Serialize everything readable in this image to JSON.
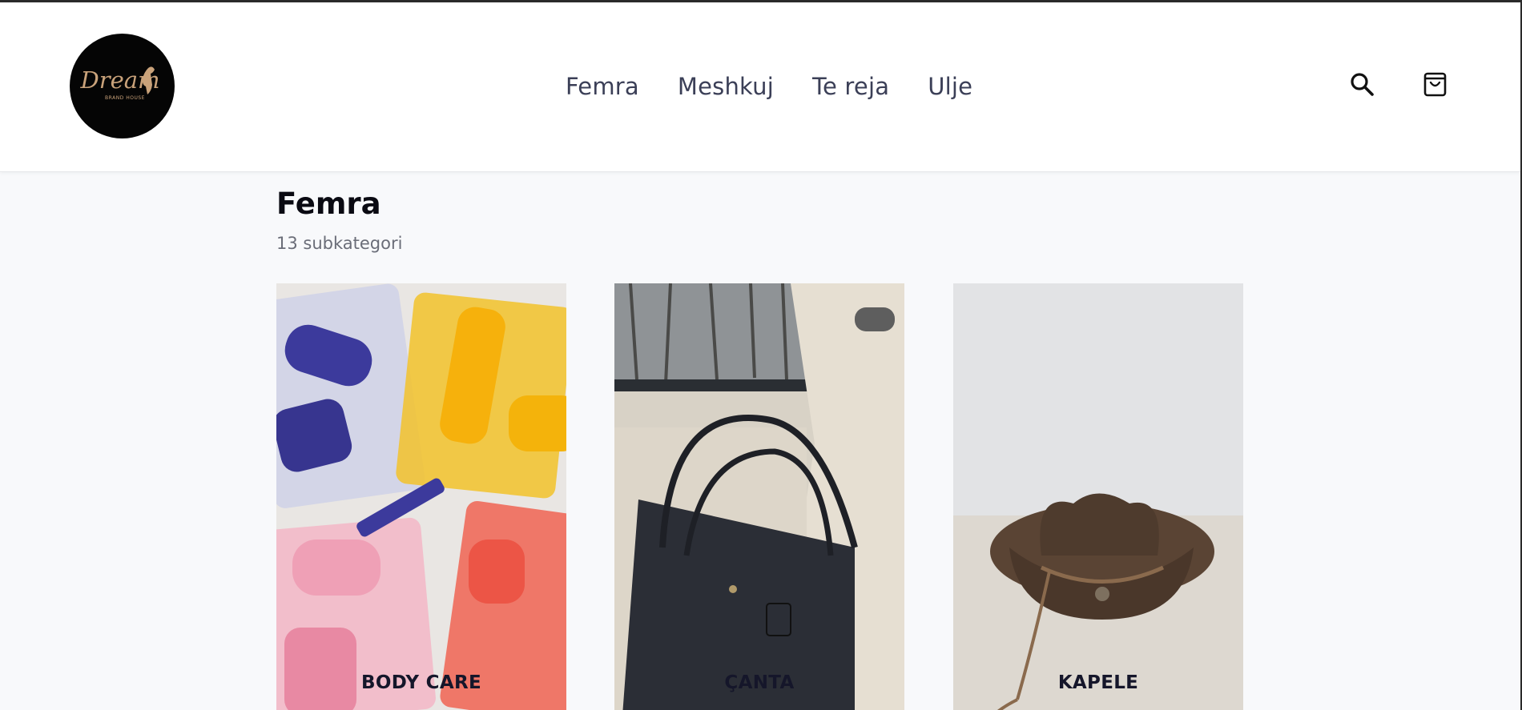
{
  "header": {
    "logo": {
      "text": "Dream",
      "subtext": "BRAND HOUSE"
    },
    "nav": [
      {
        "label": "Femra"
      },
      {
        "label": "Meshkuj"
      },
      {
        "label": "Te reja"
      },
      {
        "label": "Ulje"
      }
    ],
    "icons": {
      "search": "search-icon",
      "cart": "shopping-bag-icon"
    }
  },
  "main": {
    "title": "Femra",
    "subtitle": "13 subkategori",
    "categories": [
      {
        "label": "BODY CARE",
        "image": "body-care-products"
      },
      {
        "label": "ÇANTA",
        "image": "black-tote-bag"
      },
      {
        "label": "KAPELE",
        "image": "brown-straw-hat"
      }
    ]
  },
  "colors": {
    "nav_text": "#3b3f57",
    "page_background": "#f8f9fb",
    "title_text": "#0a0a12",
    "subtitle_text": "#6a6d78",
    "logo_gold": "#c9a27a"
  }
}
